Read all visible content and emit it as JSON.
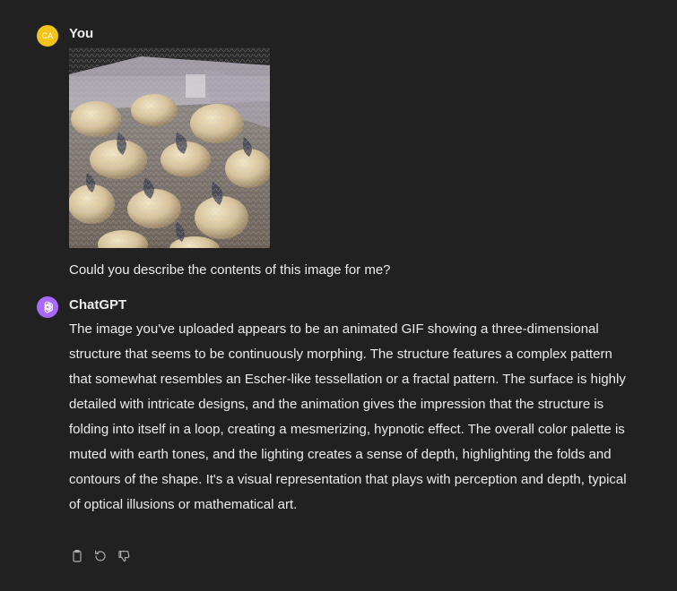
{
  "user": {
    "avatar_initials": "CA",
    "avatar_color": "#f4c31a",
    "name": "You",
    "image_alt": "uploaded animated GIF of a morphing 3D structure",
    "message": "Could you describe the contents of this image for me?"
  },
  "assistant": {
    "avatar_icon": "openai-logo-icon",
    "avatar_color": "#ab68ff",
    "name": "ChatGPT",
    "message": "The image you've uploaded appears to be an animated GIF showing a three-dimensional structure that seems to be continuously morphing. The structure features a complex pattern that somewhat resembles an Escher-like tessellation or a fractal pattern. The surface is highly detailed with intricate designs, and the animation gives the impression that the structure is folding into itself in a loop, creating a mesmerizing, hypnotic effect. The overall color palette is muted with earth tones, and the lighting creates a sense of depth, highlighting the folds and contours of the shape. It's a visual representation that plays with perception and depth, typical of optical illusions or mathematical art."
  },
  "actions": [
    {
      "icon": "copy-icon"
    },
    {
      "icon": "regenerate-icon"
    },
    {
      "icon": "thumbs-down-icon"
    }
  ],
  "colors": {
    "background": "#212121",
    "text": "#ececec",
    "icon": "#b4b4b4"
  }
}
